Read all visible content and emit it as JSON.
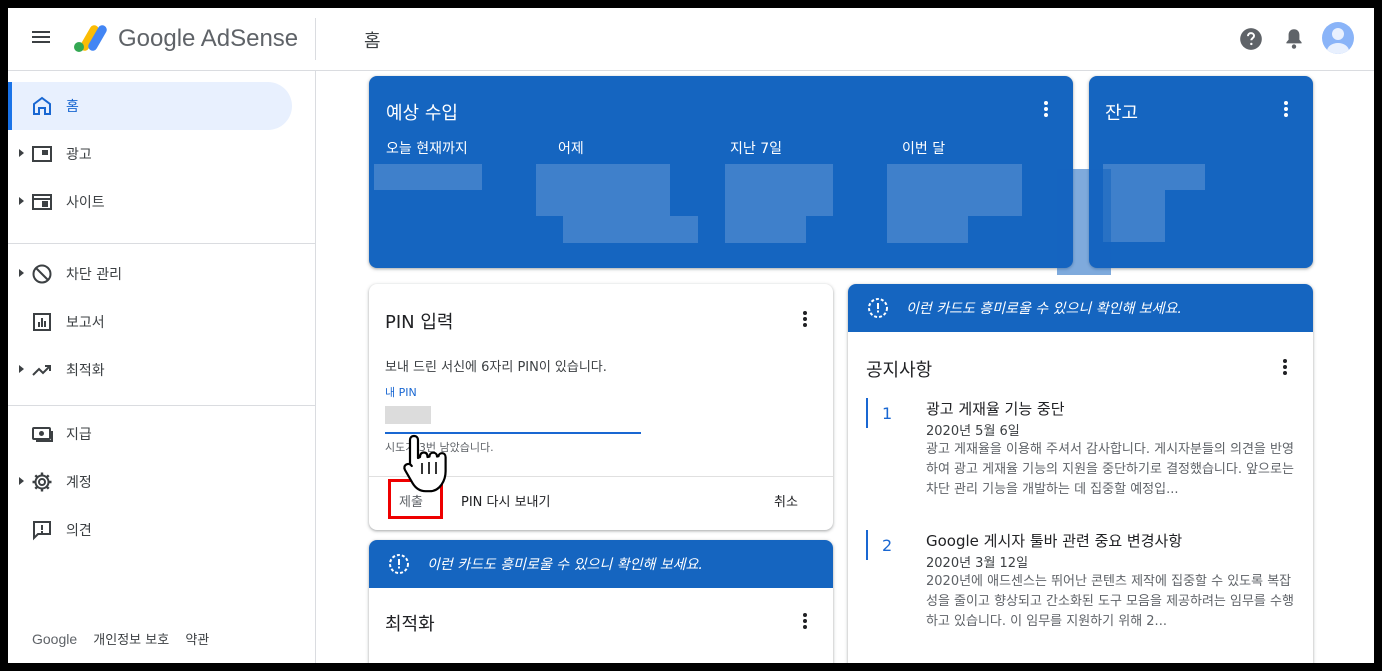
{
  "header": {
    "brand": "Google AdSense",
    "page_title": "홈"
  },
  "sidebar": {
    "items": [
      {
        "label": "홈",
        "icon": "home-icon"
      },
      {
        "label": "광고",
        "icon": "ads-icon"
      },
      {
        "label": "사이트",
        "icon": "sites-icon"
      },
      {
        "label": "차단 관리",
        "icon": "block-icon"
      },
      {
        "label": "보고서",
        "icon": "reports-icon"
      },
      {
        "label": "최적화",
        "icon": "trending-icon"
      },
      {
        "label": "지급",
        "icon": "payments-icon"
      },
      {
        "label": "계정",
        "icon": "gear-icon"
      },
      {
        "label": "의견",
        "icon": "feedback-icon"
      }
    ],
    "footer": {
      "google": "Google",
      "privacy": "개인정보 보호",
      "terms": "약관"
    }
  },
  "earnings": {
    "title": "예상 수입",
    "stats": [
      {
        "label": "오늘 현재까지"
      },
      {
        "label": "어제"
      },
      {
        "label": "지난 7일"
      },
      {
        "label": "이번 달"
      }
    ]
  },
  "balance": {
    "title": "잔고"
  },
  "pin": {
    "title": "PIN 입력",
    "description": "보내 드린 서신에 6자리 PIN이 있습니다.",
    "field_label": "내 PIN",
    "hint": "시도가 3번 남았습니다.",
    "submit": "제출",
    "resend": "PIN 다시 보내기",
    "cancel": "취소"
  },
  "suggestion_banner": "이런 카드도 흥미로울 수 있으니 확인해 보세요.",
  "optimization": {
    "title": "최적화"
  },
  "notices": {
    "title": "공지사항",
    "items": [
      {
        "num": "1",
        "title": "광고 게재율 기능 중단",
        "date": "2020년 5월 6일",
        "body": "광고 게재율을 이용해 주셔서 감사합니다. 게시자분들의 의견을 반영하여 광고 게재율 기능의 지원을 중단하기로 결정했습니다. 앞으로는 차단 관리 기능을 개발하는 데 집중할 예정입..."
      },
      {
        "num": "2",
        "title": "Google 게시자 툴바 관련 중요 변경사항",
        "date": "2020년 3월 12일",
        "body": "2020년에 애드센스는 뛰어난 콘텐츠 제작에 집중할 수 있도록 복잡성을 줄이고 향상되고 간소화된 도구 모음을 제공하려는 임무를 수행하고 있습니다. 이 임무를 지원하기 위해 2..."
      }
    ]
  },
  "colors": {
    "accent": "#1565c0",
    "active_nav": "#e8f0fe",
    "link": "#1967d2",
    "highlight": "#e00000"
  }
}
